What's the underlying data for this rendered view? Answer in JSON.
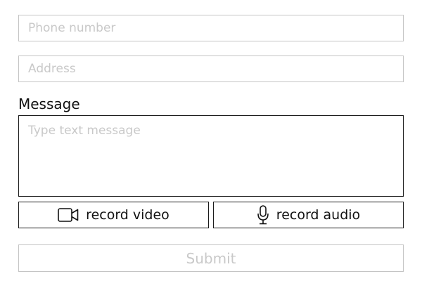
{
  "form": {
    "phone_placeholder": "Phone number",
    "address_placeholder": "Address",
    "message_label": "Message",
    "message_placeholder": "Type text message",
    "record_video_label": "record video",
    "record_audio_label": "record audio",
    "submit_label": "Submit"
  },
  "icons": {
    "video": "video-camera-icon",
    "audio": "microphone-icon"
  },
  "colors": {
    "border_light": "#c4c4c4",
    "border_dark": "#1a1a1a",
    "placeholder": "#c9c9c9",
    "text": "#111111"
  }
}
